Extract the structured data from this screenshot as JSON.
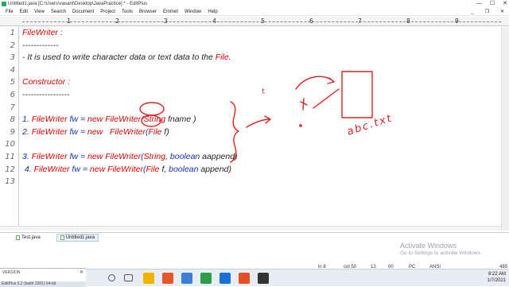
{
  "window": {
    "title": "Untitled1.java [C:\\Users\\vasant\\Desktop\\JavaPractice] * - EditPlus"
  },
  "menu": [
    "File",
    "Edit",
    "View",
    "Search",
    "Document",
    "Project",
    "Tools",
    "Browser",
    "Emmet",
    "Window",
    "Help"
  ],
  "ruler": [
    "1",
    "2",
    "3",
    "4",
    "5",
    "6",
    "7",
    "8",
    "9"
  ],
  "lines": [
    {
      "n": "1",
      "parts": [
        {
          "t": "FileWriter :",
          "c": "red"
        }
      ]
    },
    {
      "n": "2",
      "parts": [
        {
          "t": "-------------",
          "c": "plain"
        }
      ]
    },
    {
      "n": "3",
      "parts": [
        {
          "t": "- It is used to write character data or text data to the ",
          "c": "plain"
        },
        {
          "t": "File",
          "c": "red"
        },
        {
          "t": ".",
          "c": "plain"
        }
      ]
    },
    {
      "n": "4",
      "parts": []
    },
    {
      "n": "5",
      "parts": [
        {
          "t": "Constructor :",
          "c": "red"
        }
      ]
    },
    {
      "n": "6",
      "parts": [
        {
          "t": "-----------------",
          "c": "plain"
        }
      ]
    },
    {
      "n": "7",
      "parts": []
    },
    {
      "n": "8",
      "parts": [
        {
          "t": "1. ",
          "c": "blue"
        },
        {
          "t": "FileWriter",
          "c": "red"
        },
        {
          "t": " fw = ",
          "c": "blue"
        },
        {
          "t": "new",
          "c": "red"
        },
        {
          "t": " ",
          "c": "plain"
        },
        {
          "t": "FileWriter",
          "c": "red"
        },
        {
          "t": "(",
          "c": "blue"
        },
        {
          "t": "String",
          "c": "red"
        },
        {
          "t": " fname )",
          "c": "plain"
        }
      ]
    },
    {
      "n": "9",
      "parts": [
        {
          "t": "2. ",
          "c": "blue"
        },
        {
          "t": "FileWriter",
          "c": "red"
        },
        {
          "t": " fw = ",
          "c": "blue"
        },
        {
          "t": "new",
          "c": "red"
        },
        {
          "t": "   ",
          "c": "plain"
        },
        {
          "t": "FileWriter",
          "c": "red"
        },
        {
          "t": "(",
          "c": "blue"
        },
        {
          "t": "File",
          "c": "red"
        },
        {
          "t": " f)",
          "c": "plain"
        }
      ]
    },
    {
      "n": "10",
      "parts": []
    },
    {
      "n": "11",
      "parts": [
        {
          "t": "3. ",
          "c": "blue"
        },
        {
          "t": "FileWriter",
          "c": "red"
        },
        {
          "t": " fw = ",
          "c": "blue"
        },
        {
          "t": "new",
          "c": "red"
        },
        {
          "t": " ",
          "c": "plain"
        },
        {
          "t": "FileWriter",
          "c": "red"
        },
        {
          "t": "(",
          "c": "blue"
        },
        {
          "t": "String",
          "c": "red"
        },
        {
          "t": ", ",
          "c": "plain"
        },
        {
          "t": "boolean",
          "c": "blue"
        },
        {
          "t": " aappend)",
          "c": "plain"
        }
      ]
    },
    {
      "n": "12",
      "parts": [
        {
          "t": " 4. ",
          "c": "blue"
        },
        {
          "t": "FileWriter",
          "c": "red"
        },
        {
          "t": " fw = ",
          "c": "blue"
        },
        {
          "t": "new",
          "c": "red"
        },
        {
          "t": " ",
          "c": "plain"
        },
        {
          "t": "FileWriter",
          "c": "red"
        },
        {
          "t": "(",
          "c": "blue"
        },
        {
          "t": "File",
          "c": "red"
        },
        {
          "t": " f, ",
          "c": "plain"
        },
        {
          "t": "boolean",
          "c": "blue"
        },
        {
          "t": " append)",
          "c": "plain"
        }
      ]
    },
    {
      "n": "13",
      "parts": []
    }
  ],
  "tabs": [
    {
      "label": "Test.java",
      "active": false
    },
    {
      "label": "Untitled1.java",
      "active": true
    }
  ],
  "status": {
    "ln": "ln 8",
    "col": "col 50",
    "n1": "13",
    "n2": "00",
    "mode": "PC",
    "enc": "ANSI",
    "size": "485"
  },
  "output_panel": {
    "label": "VERSION",
    "build": "EditPlus 5.2 (build 2281) 64-bit"
  },
  "activation": {
    "title": "Activate Windows",
    "sub": "Go to Settings to activate Windows."
  },
  "tray": {
    "time": "8:22 AM",
    "date": "1/7/2021"
  },
  "handwriting": {
    "label": "abc.txt",
    "left_mark": "t"
  },
  "colors": {
    "keyword_red": "#d40000",
    "keyword_blue": "#1530b0",
    "ink": "#e02020"
  }
}
